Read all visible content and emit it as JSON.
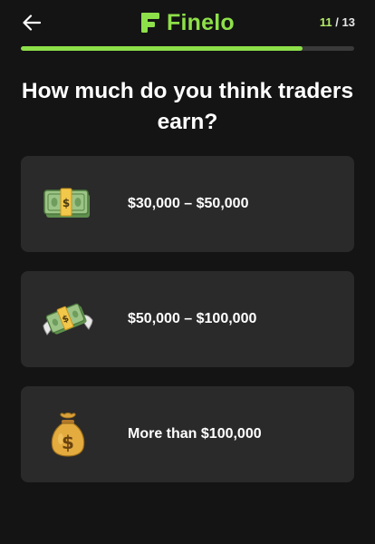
{
  "header": {
    "brand": "Finelo",
    "step_current": "11",
    "step_separator": "/",
    "step_total": "13",
    "progress_fraction": 0.846
  },
  "question": "How much do you think traders earn?",
  "options": [
    {
      "label": "$30,000 – $50,000",
      "icon": "money-banknote-icon"
    },
    {
      "label": "$50,000 – $100,000",
      "icon": "money-with-wings-icon"
    },
    {
      "label": "More than $100,000",
      "icon": "money-bag-icon"
    }
  ],
  "colors": {
    "background": "#141414",
    "card": "#2a2a2a",
    "accent": "#8ee04a",
    "track": "#3a3a3a"
  }
}
